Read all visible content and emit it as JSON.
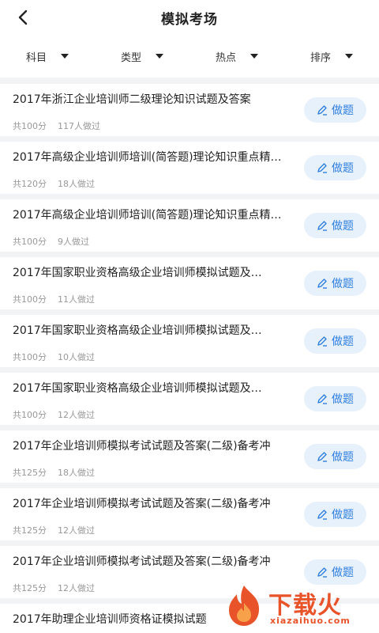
{
  "header": {
    "title": "模拟考场",
    "back_icon": "chevron-left-icon"
  },
  "filters": [
    {
      "label": "科目",
      "icon": "caret-down-icon"
    },
    {
      "label": "类型",
      "icon": "caret-down-icon"
    },
    {
      "label": "热点",
      "icon": "caret-down-icon"
    },
    {
      "label": "排序",
      "icon": "caret-down-icon"
    }
  ],
  "exams": [
    {
      "title": "2017年浙江企业培训师二级理论知识试题及答案",
      "score": "共100分",
      "count": "117人做过",
      "button": "做题"
    },
    {
      "title": "2017年高级企业培训师培训(简答题)理论知识重点精…",
      "score": "共120分",
      "count": "18人做过",
      "button": "做题"
    },
    {
      "title": "2017年高级企业培训师培训(简答题)理论知识重点精…",
      "score": "共100分",
      "count": "9人做过",
      "button": "做题"
    },
    {
      "title": "2017年国家职业资格高级企业培训师模拟试题及…",
      "score": "共100分",
      "count": "11人做过",
      "button": "做题"
    },
    {
      "title": "2017年国家职业资格高级企业培训师模拟试题及…",
      "score": "共100分",
      "count": "10人做过",
      "button": "做题"
    },
    {
      "title": "2017年国家职业资格高级企业培训师模拟试题及…",
      "score": "共100分",
      "count": "12人做过",
      "button": "做题"
    },
    {
      "title": "2017年企业培训师模拟考试试题及答案(二级)备考冲",
      "score": "共125分",
      "count": "18人做过",
      "button": "做题"
    },
    {
      "title": "2017年企业培训师模拟考试试题及答案(二级)备考冲",
      "score": "共125分",
      "count": "12人做过",
      "button": "做题"
    },
    {
      "title": "2017年企业培训师模拟考试试题及答案(二级)备考冲",
      "score": "共125分",
      "count": "12人做过",
      "button": "做题"
    },
    {
      "title": "2017年助理企业培训师资格证模拟试题",
      "score": "",
      "count": "",
      "button": ""
    }
  ],
  "watermark": {
    "text": "下载火",
    "url": "xiazaihuo.com"
  },
  "colors": {
    "accent": "#2f7fe0",
    "button_bg": "#e7f1fc",
    "watermark": "#e8532a"
  }
}
